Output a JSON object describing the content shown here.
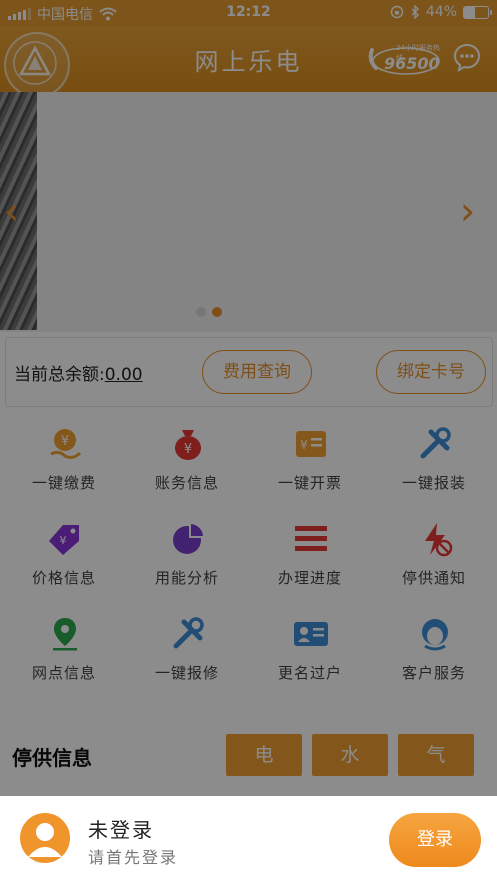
{
  "status_bar": {
    "carrier": "中国电信",
    "time": "12:12",
    "battery": "44%",
    "battery_level": 0.44,
    "icons": [
      "signal-icon",
      "wifi-icon",
      "orientation-lock-icon",
      "bluetooth-icon",
      "battery-icon"
    ]
  },
  "header": {
    "title": "网上乐电",
    "hotline_number": "96500",
    "hotline_caption": "24小时服务热线",
    "icons": [
      "logo-emblem",
      "hotline-phone-icon",
      "message-bubble-icon"
    ]
  },
  "banner": {
    "prev_arrow": "‹",
    "next_arrow": "›",
    "slide_count": 2,
    "active_slide": 2
  },
  "balance": {
    "label": "当前总余额:",
    "amount": "0.00",
    "query_button": "费用查询",
    "bind_button": "绑定卡号"
  },
  "services": [
    {
      "label": "一键缴费",
      "icon": "payment-icon",
      "color": "#f0a030"
    },
    {
      "label": "账务信息",
      "icon": "money-bag-icon",
      "color": "#e53935"
    },
    {
      "label": "一键开票",
      "icon": "invoice-icon",
      "color": "#f0a030"
    },
    {
      "label": "一键报装",
      "icon": "tools-icon",
      "color": "#3f8fd8"
    },
    {
      "label": "价格信息",
      "icon": "price-tag-icon",
      "color": "#8b35d8"
    },
    {
      "label": "用能分析",
      "icon": "pie-chart-icon",
      "color": "#7a3fd0"
    },
    {
      "label": "办理进度",
      "icon": "progress-list-icon",
      "color": "#e53935"
    },
    {
      "label": "停供通知",
      "icon": "power-off-icon",
      "color": "#e53935"
    },
    {
      "label": "网点信息",
      "icon": "location-pin-icon",
      "color": "#2fa84f"
    },
    {
      "label": "一键报修",
      "icon": "repair-tools-icon",
      "color": "#3f8fd8"
    },
    {
      "label": "更名过户",
      "icon": "id-card-icon",
      "color": "#3f8fd8"
    },
    {
      "label": "客户服务",
      "icon": "customer-service-icon",
      "color": "#3f8fd8"
    }
  ],
  "outage": {
    "title": "停供信息",
    "tabs": [
      "电",
      "水",
      "气"
    ]
  },
  "login_bar": {
    "title": "未登录",
    "subtitle": "请首先登录",
    "button": "登录"
  },
  "colors": {
    "accent": "#e8902a",
    "overlay": "rgba(0,0,0,0.45)"
  }
}
